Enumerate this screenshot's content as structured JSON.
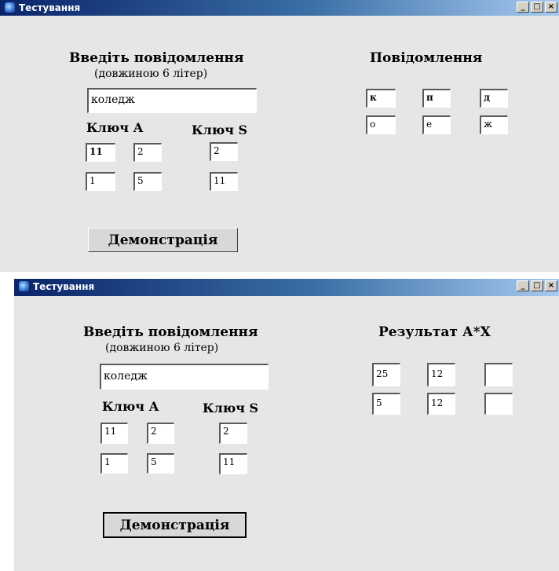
{
  "window1": {
    "title": "Тестування",
    "controls": {
      "minimize": "_",
      "maximize": "□",
      "close": "×"
    },
    "heading": "Введіть повідомлення",
    "subheading": "(довжиною 6 літер)",
    "message_input": "коледж",
    "key_a_label": "Ключ А",
    "key_s_label": "Ключ S",
    "key_a": [
      [
        "11",
        "2"
      ],
      [
        "1",
        "5"
      ]
    ],
    "key_s": [
      "2",
      "11"
    ],
    "output_label": "Повідомлення",
    "output": [
      [
        "к",
        "п",
        "д"
      ],
      [
        "о",
        "е",
        "ж"
      ]
    ],
    "demo_button": "Демонстрація"
  },
  "window2": {
    "title": "Тестування",
    "controls": {
      "minimize": "_",
      "maximize": "□",
      "close": "×"
    },
    "heading": "Введіть повідомлення",
    "subheading": "(довжиною 6 літер)",
    "message_input": "коледж",
    "key_a_label": "Ключ А",
    "key_s_label": "Ключ S",
    "key_a": [
      [
        "11",
        "2"
      ],
      [
        "1",
        "5"
      ]
    ],
    "key_s": [
      "2",
      "11"
    ],
    "output_label": "Результат А*Х",
    "output": [
      [
        "25",
        "12",
        ""
      ],
      [
        "5",
        "12",
        ""
      ]
    ],
    "demo_button": "Демонстрація"
  }
}
